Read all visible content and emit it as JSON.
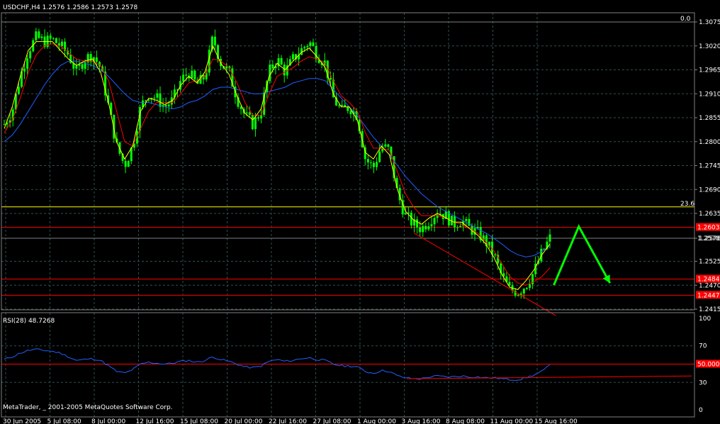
{
  "header": {
    "symbol_ohlc": "USDCHF,H4 1.2576 1.2586 1.2573 1.2578",
    "rsi_label": "RSI(28) 48.7268",
    "copyright": "MetaTrader, _ 2001-2005 MetaQuotes Software Corp."
  },
  "colors": {
    "background": "#000000",
    "candle": "#00ff00",
    "grid": "#2f4f4f",
    "axis": "#808080",
    "level_line": "#ff0000",
    "fib_line": "#ffff00",
    "ma_fast": "#ffff00",
    "ma_mid": "#ff0000",
    "ma_slow": "#1e60ff",
    "rsi": "#1e60ff",
    "arrow": "#00ff00"
  },
  "chart_data": [
    {
      "type": "candlestick",
      "title": "USDCHF,H4 1.2576 1.2586 1.2573 1.2578",
      "y_ticks": [
        "1.3075",
        "1.3020",
        "1.2965",
        "1.2910",
        "1.2855",
        "1.2800",
        "1.2745",
        "1.2690",
        "1.2635",
        "1.2578",
        "1.2525",
        "1.2470",
        "1.2415"
      ],
      "ylim": [
        1.2415,
        1.3075
      ],
      "x_ticks": [
        "30 Jun 2005",
        "5 Jul 08:00",
        "8 Jul 00:00",
        "12 Jul 16:00",
        "15 Jul 08:00",
        "20 Jul 00:00",
        "22 Jul 16:00",
        "27 Jul 08:00",
        "1 Aug 00:00",
        "3 Aug 16:00",
        "8 Aug 08:00",
        "11 Aug 00:00",
        "15 Aug 16:00"
      ],
      "close_path": [
        1.284,
        1.287,
        1.295,
        1.301,
        1.304,
        1.303,
        1.3035,
        1.302,
        1.3,
        1.296,
        1.299,
        1.3,
        1.297,
        1.288,
        1.279,
        1.2745,
        1.279,
        1.288,
        1.291,
        1.29,
        1.288,
        1.2895,
        1.294,
        1.296,
        1.293,
        1.295,
        1.304,
        1.298,
        1.296,
        1.29,
        1.286,
        1.284,
        1.287,
        1.296,
        1.299,
        1.296,
        1.299,
        1.301,
        1.303,
        1.3,
        1.298,
        1.29,
        1.287,
        1.288,
        1.286,
        1.276,
        1.274,
        1.279,
        1.278,
        1.268,
        1.263,
        1.261,
        1.26,
        1.262,
        1.264,
        1.263,
        1.261,
        1.262,
        1.26,
        1.259,
        1.257,
        1.254,
        1.249,
        1.246,
        1.2455,
        1.247,
        1.25,
        1.2545,
        1.2578
      ],
      "ma_fast": [
        1.283,
        1.288,
        1.295,
        1.301,
        1.303,
        1.303,
        1.303,
        1.301,
        1.299,
        1.2975,
        1.2985,
        1.299,
        1.296,
        1.289,
        1.28,
        1.276,
        1.279,
        1.287,
        1.29,
        1.2895,
        1.2885,
        1.2895,
        1.293,
        1.295,
        1.2935,
        1.296,
        1.302,
        1.298,
        1.2955,
        1.2905,
        1.2865,
        1.285,
        1.2875,
        1.295,
        1.298,
        1.2965,
        1.2985,
        1.3005,
        1.3015,
        1.2995,
        1.297,
        1.291,
        1.288,
        1.288,
        1.285,
        1.2775,
        1.276,
        1.279,
        1.277,
        1.269,
        1.264,
        1.262,
        1.261,
        1.2625,
        1.2635,
        1.2625,
        1.2615,
        1.2615,
        1.26,
        1.2585,
        1.2565,
        1.2535,
        1.2495,
        1.2465,
        1.246,
        1.248,
        1.2505,
        1.254,
        1.2565
      ],
      "ma_mid": [
        1.282,
        1.285,
        1.29,
        1.296,
        1.3,
        1.302,
        1.3025,
        1.302,
        1.3005,
        1.299,
        1.2985,
        1.2985,
        1.2975,
        1.294,
        1.287,
        1.28,
        1.279,
        1.283,
        1.287,
        1.289,
        1.289,
        1.289,
        1.291,
        1.2935,
        1.294,
        1.295,
        1.299,
        1.2985,
        1.297,
        1.2935,
        1.289,
        1.286,
        1.286,
        1.291,
        1.295,
        1.296,
        1.297,
        1.2985,
        1.2995,
        1.299,
        1.298,
        1.294,
        1.2905,
        1.289,
        1.287,
        1.282,
        1.2785,
        1.2785,
        1.278,
        1.273,
        1.268,
        1.265,
        1.263,
        1.263,
        1.263,
        1.2625,
        1.2615,
        1.261,
        1.26,
        1.259,
        1.257,
        1.255,
        1.252,
        1.249,
        1.2475,
        1.247,
        1.2478,
        1.249,
        1.251
      ],
      "ma_slow": [
        1.28,
        1.2815,
        1.284,
        1.287,
        1.29,
        1.293,
        1.2955,
        1.2975,
        1.2985,
        1.2985,
        1.298,
        1.2975,
        1.2965,
        1.295,
        1.293,
        1.291,
        1.2895,
        1.289,
        1.289,
        1.2885,
        1.288,
        1.2875,
        1.288,
        1.289,
        1.2895,
        1.2905,
        1.292,
        1.2925,
        1.2925,
        1.292,
        1.2915,
        1.291,
        1.291,
        1.2915,
        1.292,
        1.2925,
        1.2935,
        1.294,
        1.2945,
        1.2945,
        1.294,
        1.292,
        1.29,
        1.288,
        1.286,
        1.2835,
        1.281,
        1.279,
        1.277,
        1.2745,
        1.272,
        1.27,
        1.268,
        1.2665,
        1.265,
        1.264,
        1.263,
        1.262,
        1.261,
        1.26,
        1.259,
        1.2578,
        1.2565,
        1.255,
        1.254,
        1.2535,
        1.2538,
        1.2548,
        1.256
      ],
      "levels": [
        {
          "price": 1.3075,
          "color": "#808080",
          "label": "0.0"
        },
        {
          "price": 1.265,
          "color": "#ffff00",
          "label": "23.6"
        },
        {
          "price": 1.2603,
          "color": "#ff0000",
          "label": "1.2603"
        },
        {
          "price": 1.2578,
          "color": "#808080",
          "label": "1.2578"
        },
        {
          "price": 1.2484,
          "color": "#ff0000",
          "label": "1.2484"
        },
        {
          "price": 1.2447,
          "color": "#ff0000",
          "label": "1.2447"
        }
      ],
      "trendline": [
        [
          0.595,
          1.259
        ],
        [
          0.8,
          1.24
        ]
      ],
      "forecast_arrow": [
        [
          0.797,
          1.247
        ],
        [
          0.833,
          1.2605
        ],
        [
          0.878,
          1.2475
        ]
      ]
    },
    {
      "type": "line",
      "title": "RSI(28) 48.7268",
      "y_ticks": [
        "100",
        "70",
        "50.0000",
        "30",
        "0"
      ],
      "ylim": [
        0,
        100
      ],
      "levels": [
        {
          "value": 50,
          "color": "#ff0000",
          "label": "50.0000"
        }
      ],
      "rsi_path": [
        55,
        58,
        62,
        65,
        66,
        65,
        64,
        62,
        58,
        54,
        55,
        56,
        54,
        48,
        42,
        40,
        44,
        50,
        52,
        51,
        50,
        51,
        53,
        54,
        52,
        54,
        58,
        55,
        53,
        50,
        47,
        46,
        48,
        53,
        55,
        53,
        54,
        56,
        57,
        55,
        54,
        50,
        48,
        48,
        47,
        42,
        40,
        43,
        42,
        37,
        35,
        34,
        34,
        36,
        37,
        36,
        36,
        37,
        36,
        36,
        35,
        35,
        34,
        33,
        33,
        35,
        38,
        42,
        48.7
      ]
    }
  ]
}
